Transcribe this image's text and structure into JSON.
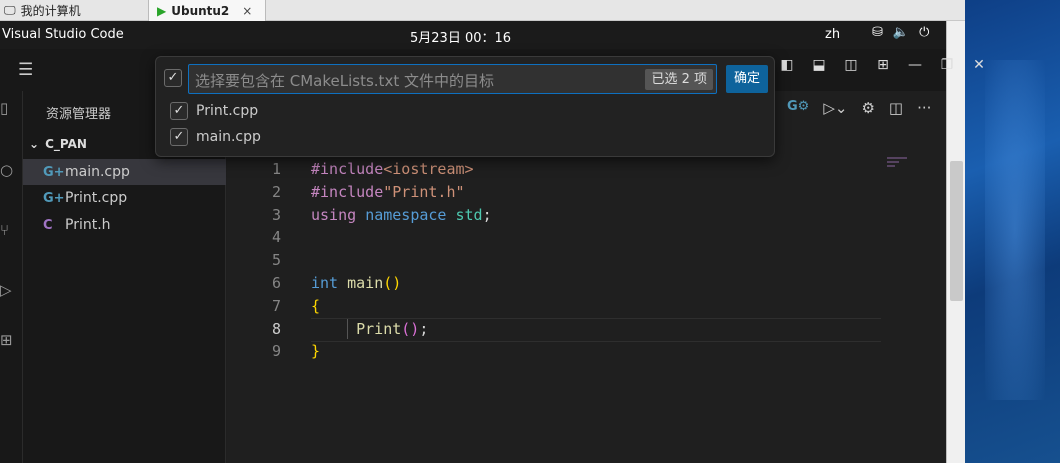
{
  "host": {
    "tabs": [
      {
        "label": "我的计算机"
      },
      {
        "label": "Ubuntu2",
        "close": "×"
      }
    ]
  },
  "topbar": {
    "app_name": "Visual Studio Code",
    "clock": "5月23日  00：16",
    "input_lang": "zh"
  },
  "sidebar": {
    "title": "资源管理器",
    "folder": "C_PAN",
    "files": [
      {
        "name": "main.cpp",
        "icon": "cpp-icon",
        "selected": true
      },
      {
        "name": "Print.cpp",
        "icon": "cpp-icon",
        "selected": false
      },
      {
        "name": "Print.h",
        "icon": "c-header-icon",
        "selected": false
      }
    ]
  },
  "quickpick": {
    "placeholder": "选择要包含在 CMakeLists.txt 文件中的目标",
    "selected_count": "已选 2 项",
    "ok_label": "确定",
    "items": [
      {
        "label": "Print.cpp",
        "checked": true
      },
      {
        "label": "main.cpp",
        "checked": true
      }
    ]
  },
  "editor": {
    "active_line": 8,
    "lines": [
      "#include<iostream>",
      "#include\"Print.h\"",
      "using namespace std;",
      "",
      "",
      "int main()",
      "{",
      "    Print();",
      "}"
    ]
  },
  "colors": {
    "accent": "#0e639c",
    "focus_border": "#0e70c0"
  }
}
